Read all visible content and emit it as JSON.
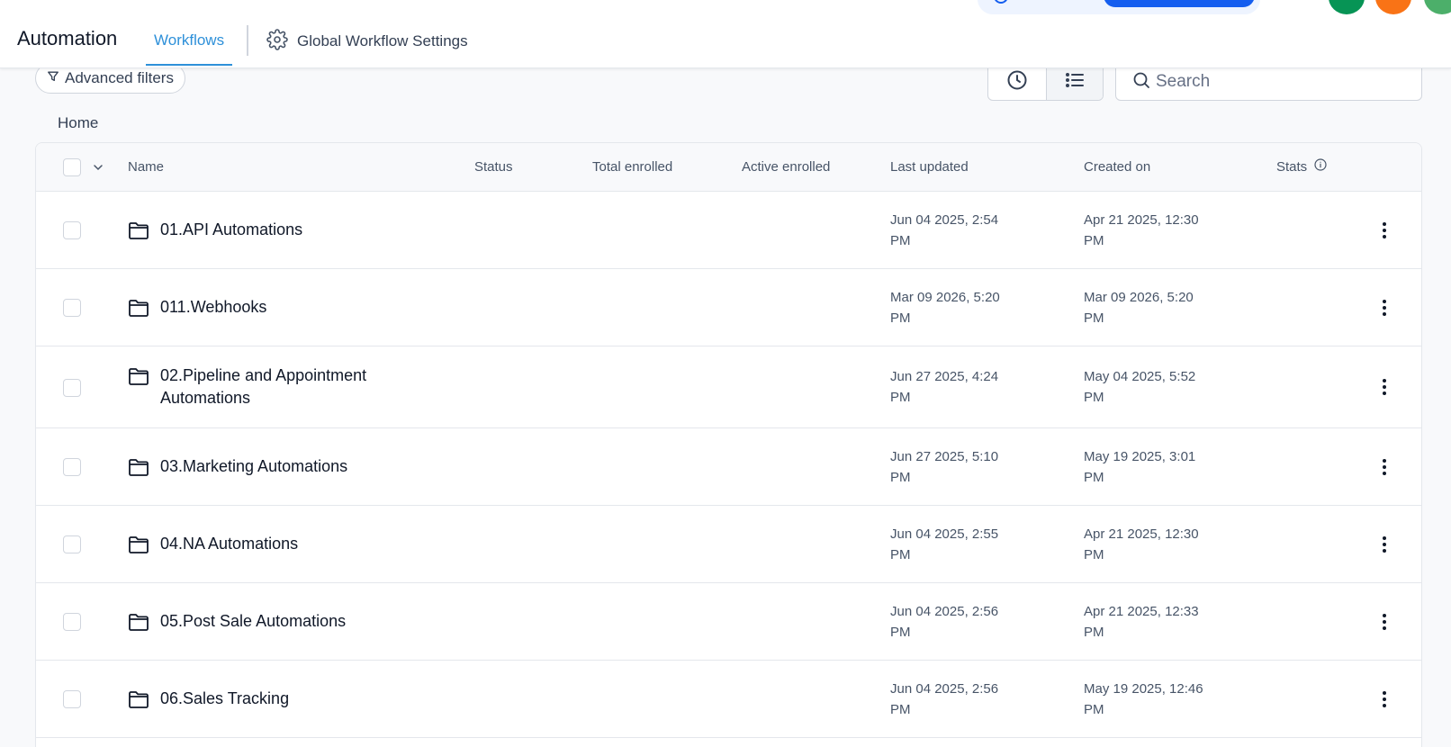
{
  "header": {
    "title": "Automation",
    "tabs": [
      {
        "label": "Workflows",
        "active": true
      },
      {
        "label": "Global Workflow Settings",
        "icon": "gear-icon"
      }
    ]
  },
  "toolbar": {
    "advanced_filters_label": "Advanced filters",
    "search_placeholder": "Search",
    "views": [
      {
        "icon": "clock-icon",
        "active": false
      },
      {
        "icon": "list-icon",
        "active": true
      }
    ]
  },
  "breadcrumb": "Home",
  "table": {
    "columns": {
      "name": "Name",
      "status": "Status",
      "total_enrolled": "Total enrolled",
      "active_enrolled": "Active enrolled",
      "last_updated": "Last updated",
      "created_on": "Created on",
      "stats": "Stats"
    },
    "rows": [
      {
        "name": "01.API Automations",
        "last_updated_1": "Jun 04 2025, 2:54",
        "last_updated_2": "PM",
        "created_1": "Apr 21 2025, 12:30",
        "created_2": "PM"
      },
      {
        "name": "011.Webhooks",
        "last_updated_1": "Mar 09 2026, 5:20",
        "last_updated_2": "PM",
        "created_1": "Mar 09 2026, 5:20",
        "created_2": "PM"
      },
      {
        "name": "02.Pipeline and Appointment Automations",
        "last_updated_1": "Jun 27 2025, 4:24",
        "last_updated_2": "PM",
        "created_1": "May 04 2025, 5:52",
        "created_2": "PM"
      },
      {
        "name": "03.Marketing Automations",
        "last_updated_1": "Jun 27 2025, 5:10",
        "last_updated_2": "PM",
        "created_1": "May 19 2025, 3:01",
        "created_2": "PM"
      },
      {
        "name": "04.NA Automations",
        "last_updated_1": "Jun 04 2025, 2:55",
        "last_updated_2": "PM",
        "created_1": "Apr 21 2025, 12:30",
        "created_2": "PM"
      },
      {
        "name": "05.Post Sale Automations",
        "last_updated_1": "Jun 04 2025, 2:56",
        "last_updated_2": "PM",
        "created_1": "Apr 21 2025, 12:33",
        "created_2": "PM"
      },
      {
        "name": "06.Sales Tracking",
        "last_updated_1": "Jun 04 2025, 2:56",
        "last_updated_2": "PM",
        "created_1": "May 19 2025, 12:46",
        "created_2": "PM"
      }
    ]
  },
  "colors": {
    "accent": "#2e90d9",
    "primary_button": "#155eef"
  }
}
